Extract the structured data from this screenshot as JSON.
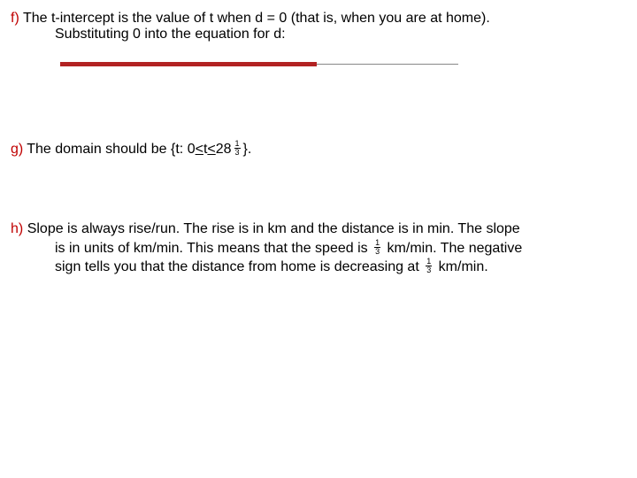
{
  "f": {
    "label": "f)",
    "line1": "The t-intercept is the value of t when d = 0 (that is, when you are at home).",
    "line2": "Substituting 0 into the equation for d:"
  },
  "g": {
    "label": "g)",
    "prefix": "The domain should be {t: 0 ",
    "lt1": "<",
    "mid": "  t ",
    "lt2": "<",
    "space": " 28 ",
    "frac_num": "1",
    "frac_den": "3",
    "suffix": " }."
  },
  "h": {
    "label": "h)",
    "part1": "Slope is always rise/run. The rise is in km and the distance is in min. The slope",
    "part2_a": "is in units of km/min. This means that the speed is ",
    "frac1_num": "1",
    "frac1_den": "3",
    "part2_b": " km/min. The negative",
    "part3_a": "sign tells you that the distance from home is decreasing at ",
    "frac2_num": "1",
    "frac2_den": "3",
    "part3_b": " km/min."
  }
}
